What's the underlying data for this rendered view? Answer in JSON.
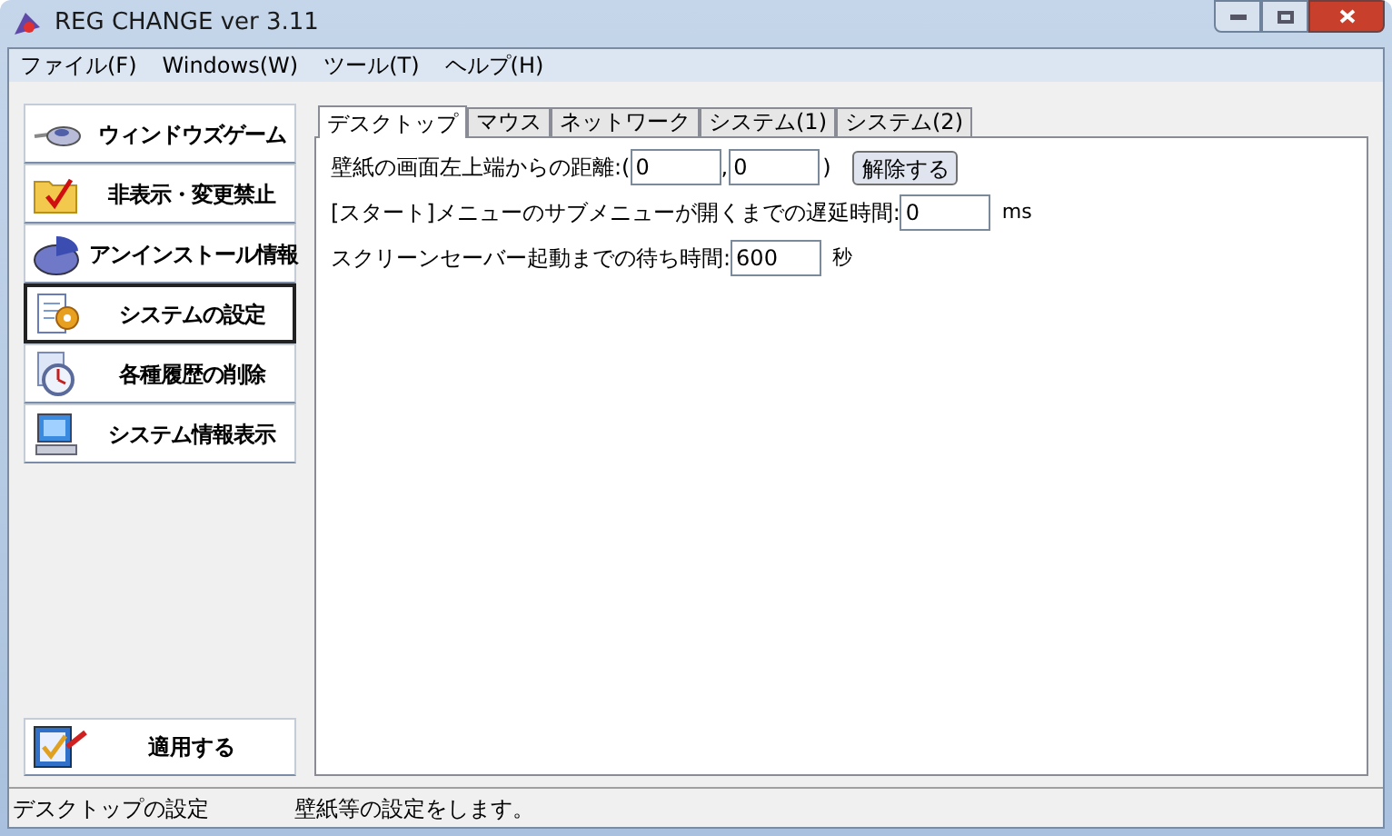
{
  "window": {
    "title": "REG CHANGE ver 3.11"
  },
  "menu": [
    "ファイル(F)",
    "Windows(W)",
    "ツール(T)",
    "ヘルプ(H)"
  ],
  "sidebar": {
    "items": [
      {
        "label": "ウィンドウズゲーム",
        "kind": "mouse",
        "selected": false
      },
      {
        "label": "非表示・変更禁止",
        "kind": "folder",
        "selected": false
      },
      {
        "label": "アンインストール情報",
        "kind": "pie",
        "selected": false
      },
      {
        "label": "システムの設定",
        "kind": "notepad",
        "selected": true
      },
      {
        "label": "各種履歴の削除",
        "kind": "clock",
        "selected": false
      },
      {
        "label": "システム情報表示",
        "kind": "monitor",
        "selected": false
      }
    ],
    "apply_button": "適用する"
  },
  "tabs": [
    {
      "label": "デスクトップ",
      "selected": true
    },
    {
      "label": "マウス",
      "selected": false
    },
    {
      "label": "ネットワーク",
      "selected": false
    },
    {
      "label": "システム(1)",
      "selected": false
    },
    {
      "label": "システム(2)",
      "selected": false
    }
  ],
  "settings": [
    {
      "kind": "pair",
      "label": "壁紙の画面左上端からの距離:(",
      "value_1": "0",
      "separator": ",",
      "value_2": "0",
      "close": ")",
      "button": "解除する"
    },
    {
      "kind": "single",
      "label": "[スタート]メニューのサブメニューが開くまでの遅延時間:",
      "value": "0",
      "unit": "ms"
    },
    {
      "kind": "single",
      "label": "スクリーンセーバー起動までの待ち時間:",
      "value": "600",
      "unit": "秒"
    }
  ],
  "status_bar": [
    "デスクトップの設定",
    "壁紙等の設定をします。"
  ]
}
